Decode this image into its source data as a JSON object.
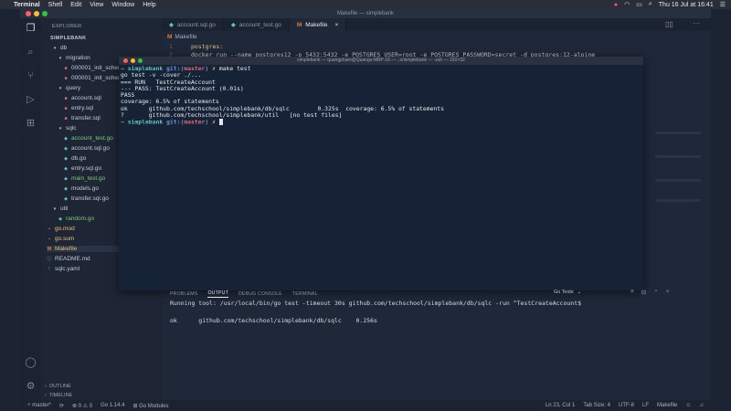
{
  "menubar": {
    "apple": "",
    "app": "Terminal",
    "items": [
      "Shell",
      "Edit",
      "View",
      "Window",
      "Help"
    ],
    "clock": "Thu 16 Jul at 16:41"
  },
  "window": {
    "title": "Makefile — simplebank"
  },
  "explorer": {
    "header": "EXPLORER",
    "root": "SIMPLEBANK",
    "items": [
      {
        "label": "db",
        "kind": "folder"
      },
      {
        "label": "migration",
        "kind": "folder"
      },
      {
        "label": "000001_init_schema...",
        "kind": "sql"
      },
      {
        "label": "000001_init_schema...",
        "kind": "sql"
      },
      {
        "label": "query",
        "kind": "folder"
      },
      {
        "label": "account.sql",
        "kind": "sql"
      },
      {
        "label": "entry.sql",
        "kind": "sql"
      },
      {
        "label": "transfer.sql",
        "kind": "sql"
      },
      {
        "label": "sqlc",
        "kind": "folder"
      },
      {
        "label": "account_test.go",
        "kind": "go-test"
      },
      {
        "label": "account.sql.go",
        "kind": "go"
      },
      {
        "label": "db.go",
        "kind": "go"
      },
      {
        "label": "entry.sql.go",
        "kind": "go"
      },
      {
        "label": "main_test.go",
        "kind": "go-test"
      },
      {
        "label": "models.go",
        "kind": "go"
      },
      {
        "label": "transfer.sql.go",
        "kind": "go"
      },
      {
        "label": "util",
        "kind": "folder"
      },
      {
        "label": "random.go",
        "kind": "go-test"
      },
      {
        "label": "go.mod",
        "kind": "mod"
      },
      {
        "label": "go.sum",
        "kind": "mod"
      },
      {
        "label": "Makefile",
        "kind": "make"
      },
      {
        "label": "README.md",
        "kind": "md"
      },
      {
        "label": "sqlc.yaml",
        "kind": "yaml"
      }
    ],
    "outline": "OUTLINE",
    "timeline": "TIMELINE"
  },
  "tabs": [
    {
      "label": "account.sql.go",
      "active": false
    },
    {
      "label": "account_test.go",
      "active": false
    },
    {
      "label": "Makefile",
      "active": true
    }
  ],
  "editor": {
    "breadcrumb": "Makefile",
    "lines": [
      {
        "n": "1",
        "text": "postgres:"
      },
      {
        "n": "2",
        "text": "    docker run --name postgres12 -p 5432:5432 -e POSTGRES_USER=root -e POSTGRES_PASSWORD=secret -d postgres:12-alpine"
      }
    ]
  },
  "terminal": {
    "title": "simplebank — quangpham@Quangs-MBP-16 — ..o/simplebank — -zsh — 150×32",
    "prompt_dir": "simplebank",
    "prompt_git": "git:",
    "prompt_branch_open": "(",
    "prompt_branch": "master",
    "prompt_branch_close": ")",
    "prompt_x": "✗",
    "command": "make test",
    "output": [
      "go test -v -cover ./...",
      "=== RUN   TestCreateAccount",
      "--- PASS: TestCreateAccount (0.01s)",
      "PASS",
      "coverage: 6.5% of statements",
      "ok      github.com/techschool/simplebank/db/sqlc        0.325s  coverage: 6.5% of statements",
      "?       github.com/techschool/simplebank/util   [no test files]"
    ]
  },
  "panel": {
    "tabs": [
      "PROBLEMS",
      "OUTPUT",
      "DEBUG CONSOLE",
      "TERMINAL"
    ],
    "active_tab": "OUTPUT",
    "select": "Go Tests",
    "line1": "Running tool: /usr/local/bin/go test -timeout 30s github.com/techschool/simplebank/db/sqlc -run ^TestCreateAccount$",
    "line2": "ok      github.com/techschool/simplebank/db/sqlc    0.256s"
  },
  "statusbar": {
    "branch": "master*",
    "problems": "⊗ 0 ⚠ 0",
    "go_version": "Go 1.14.4",
    "modules": "Go Modules",
    "position": "Ln 23, Col 1",
    "tab_size": "Tab Size: 4",
    "encoding": "UTF-8",
    "eol": "LF",
    "language": "Makefile"
  }
}
